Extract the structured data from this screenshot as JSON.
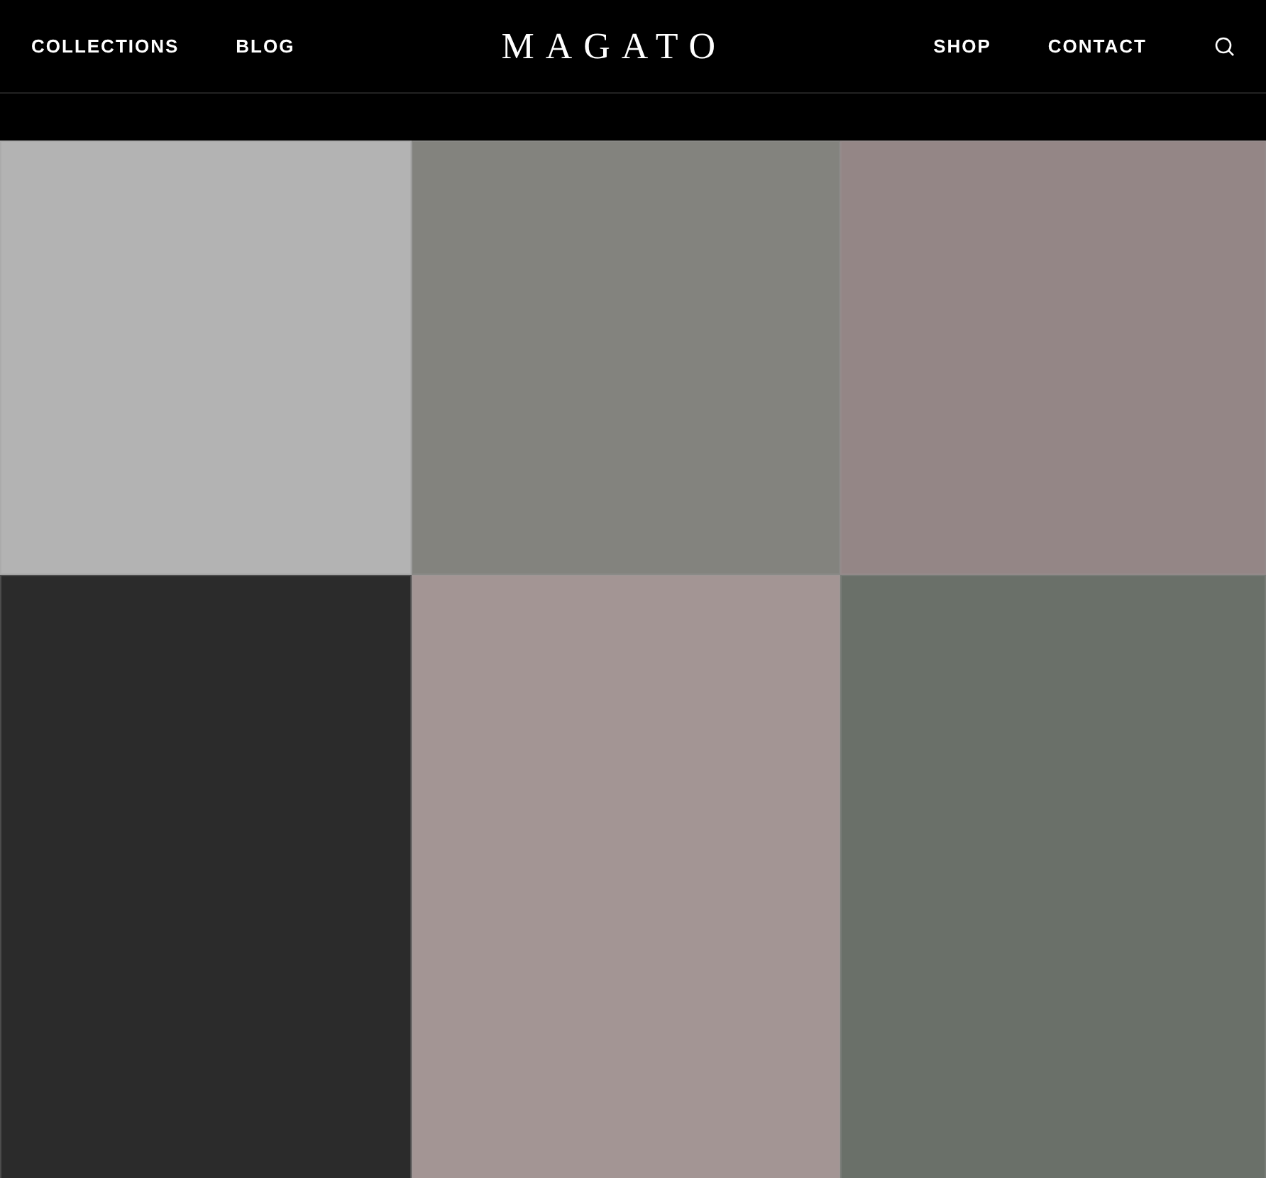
{
  "nav_left": [
    "COLLECTIONS",
    "BLOG"
  ],
  "logo": "MAGATO",
  "nav_right": [
    "SHOP",
    "CONTACT"
  ],
  "tiles": [
    {
      "color": "#b3b3b3"
    },
    {
      "color": "#83837e"
    },
    {
      "color": "#948686"
    },
    {
      "color": "#2b2b2b"
    },
    {
      "color": "#a39594"
    },
    {
      "color": "#6a7069"
    }
  ]
}
